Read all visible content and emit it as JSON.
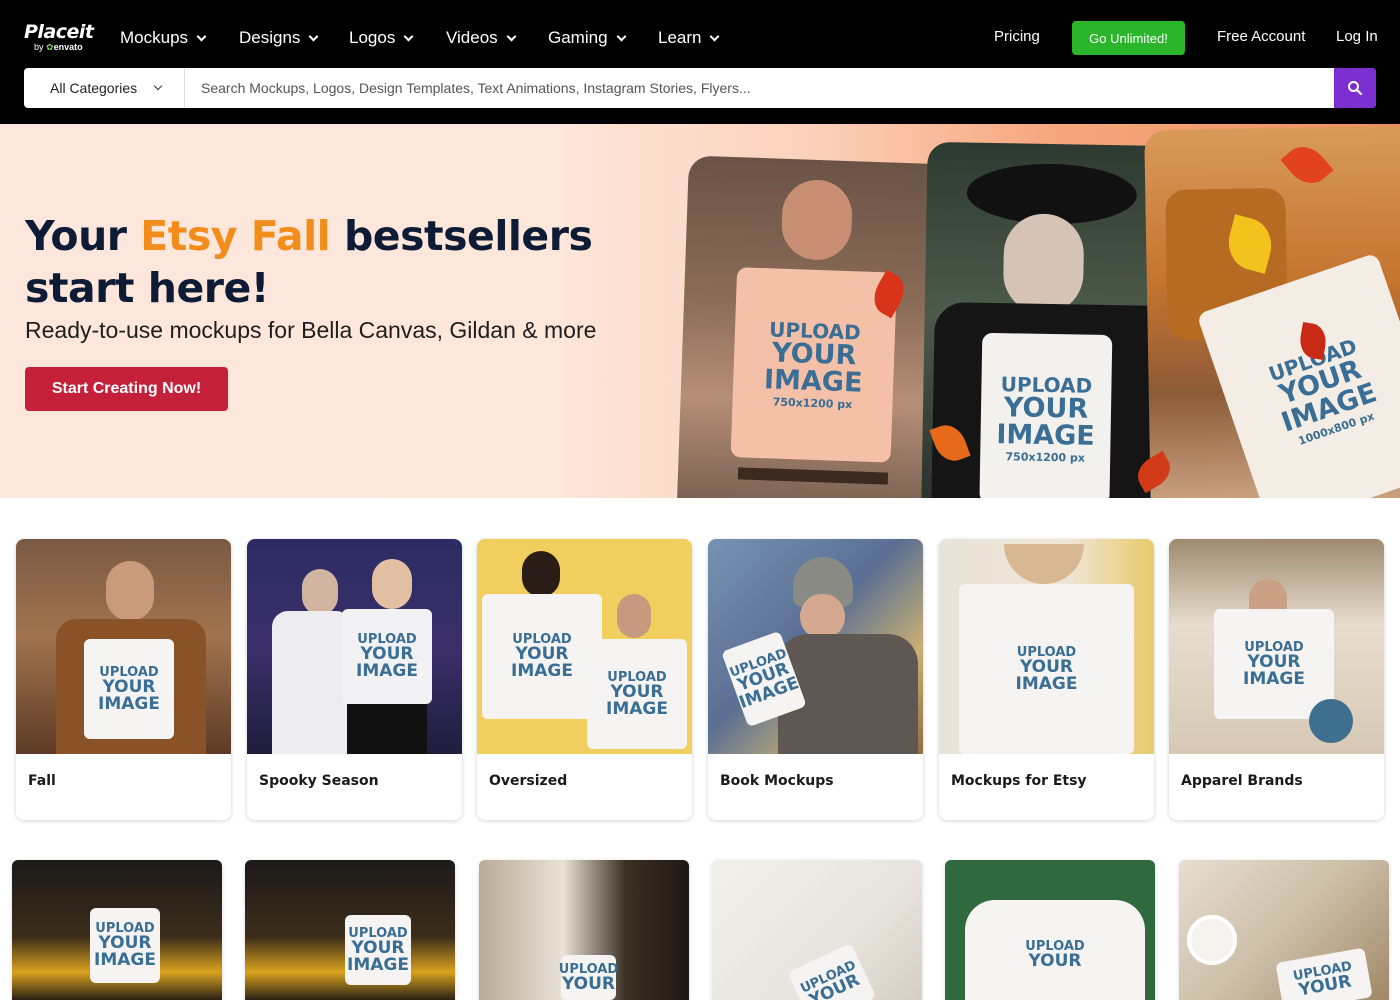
{
  "header": {
    "logo": {
      "word": "Placeit",
      "by": "by",
      "brand": "envato"
    },
    "nav": [
      {
        "label": "Mockups"
      },
      {
        "label": "Designs"
      },
      {
        "label": "Logos"
      },
      {
        "label": "Videos"
      },
      {
        "label": "Gaming"
      },
      {
        "label": "Learn"
      }
    ],
    "pricing": "Pricing",
    "go_unlimited": "Go Unlimited!",
    "free_account": "Free Account",
    "login": "Log In",
    "accent_color": "#2bb52b"
  },
  "search": {
    "category": "All Categories",
    "placeholder": "Search Mockups, Logos, Design Templates, Text Animations, Instagram Stories, Flyers...",
    "button_icon": "search-icon",
    "button_color": "#7b2fd1"
  },
  "hero": {
    "title_part1": "Your ",
    "title_accent": "Etsy Fall",
    "title_part2": " bestsellers start here!",
    "subtitle": "Ready-to-use mockups for Bella Canvas, Gildan & more",
    "cta": "Start Creating Now!",
    "cta_color": "#c4203a",
    "accent_color": "#f28c1a",
    "photos": [
      {
        "line1": "UPLOAD",
        "line2": "YOUR",
        "line3": "IMAGE",
        "size": "750x1200 px"
      },
      {
        "line1": "UPLOAD",
        "line2": "YOUR",
        "line3": "IMAGE",
        "size": "750x1200 px"
      },
      {
        "line1": "UPLOAD",
        "line2": "YOUR",
        "line3": "IMAGE",
        "size": "1000x800 px"
      }
    ]
  },
  "categories": [
    {
      "label": "Fall"
    },
    {
      "label": "Spooky Season"
    },
    {
      "label": "Oversized"
    },
    {
      "label": "Book Mockups"
    },
    {
      "label": "Mockups for Etsy"
    },
    {
      "label": "Apparel Brands"
    }
  ],
  "mockup_text": {
    "line1": "UPLOAD",
    "line2": "YOUR",
    "line3": "IMAGE"
  }
}
